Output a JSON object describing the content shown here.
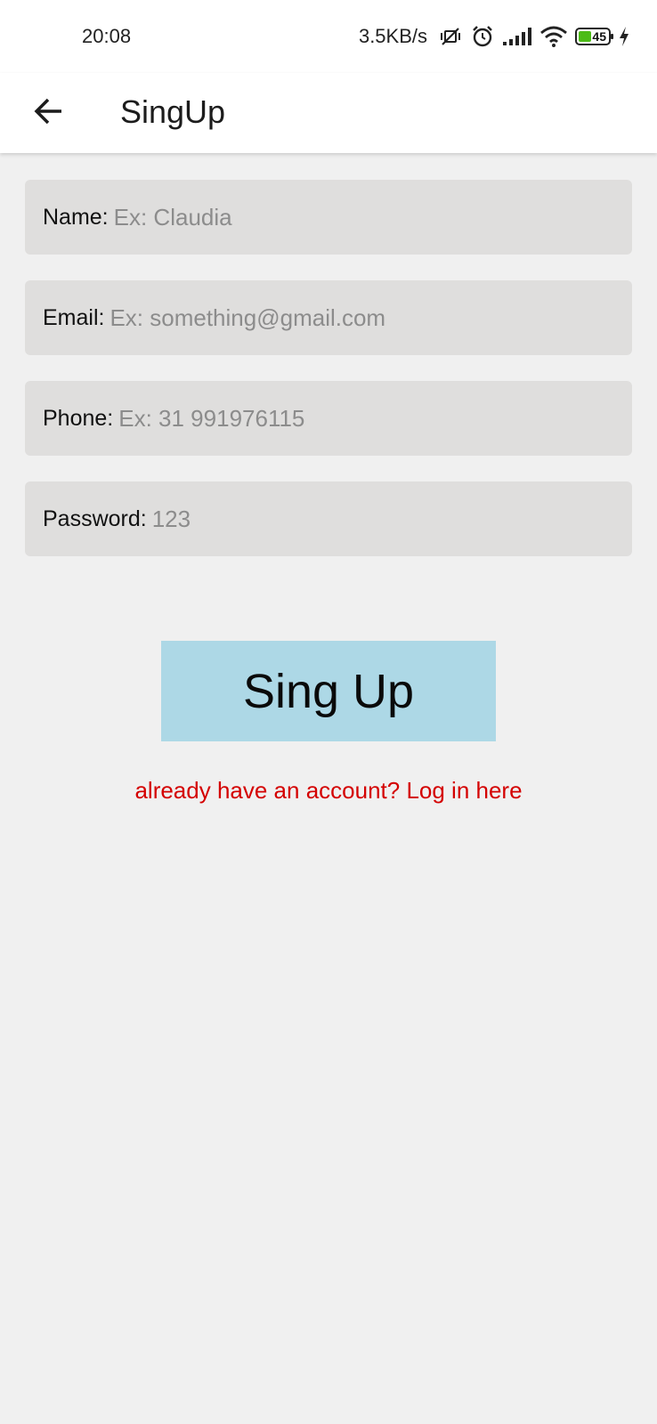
{
  "status_bar": {
    "time": "20:08",
    "net_speed": "3.5KB/s",
    "battery_level": "45",
    "battery_fraction": 0.45,
    "icons": [
      "vibrate-off-icon",
      "alarm-icon",
      "cellular-signal-icon",
      "wifi-icon",
      "battery-icon",
      "charging-icon"
    ]
  },
  "app_bar": {
    "title": "SingUp",
    "back_icon": "arrow-left-icon"
  },
  "form": {
    "name": {
      "label": "Name:",
      "placeholder": "Ex: Claudia",
      "value": ""
    },
    "email": {
      "label": "Email:",
      "placeholder": "Ex: something@gmail.com",
      "value": ""
    },
    "phone": {
      "label": "Phone:",
      "placeholder": "Ex: 31 991976115",
      "value": ""
    },
    "password": {
      "label": "Password:",
      "placeholder": "123",
      "value": ""
    }
  },
  "submit_label": "Sing Up",
  "login_link": "already have an account? Log in here",
  "colors": {
    "background": "#f0f0f0",
    "field_background": "#dfdedd",
    "button_background": "#add8e6",
    "link_color": "#d40000",
    "battery_fill": "#4cbb17"
  }
}
